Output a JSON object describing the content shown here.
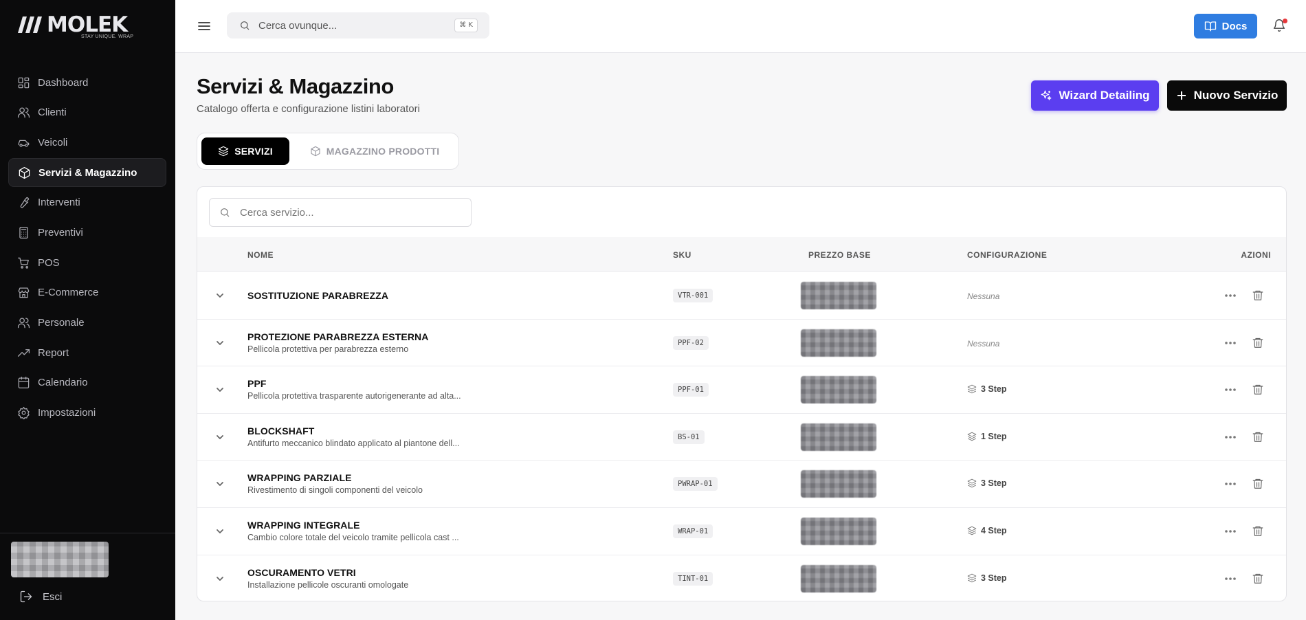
{
  "brand": {
    "name": "MOLEK",
    "tagline": "STAY UNIQUE. WRAP"
  },
  "sidebar": {
    "items": [
      {
        "label": "Dashboard",
        "icon": "dashboard-icon"
      },
      {
        "label": "Clienti",
        "icon": "users-icon"
      },
      {
        "label": "Veicoli",
        "icon": "car-icon"
      },
      {
        "label": "Servizi & Magazzino",
        "icon": "package-icon",
        "active": true
      },
      {
        "label": "Interventi",
        "icon": "wrench-icon"
      },
      {
        "label": "Preventivi",
        "icon": "calculator-icon"
      },
      {
        "label": "POS",
        "icon": "cart-icon"
      },
      {
        "label": "E-Commerce",
        "icon": "store-icon"
      },
      {
        "label": "Personale",
        "icon": "team-icon"
      },
      {
        "label": "Report",
        "icon": "trend-icon"
      },
      {
        "label": "Calendario",
        "icon": "calendar-icon"
      },
      {
        "label": "Impostazioni",
        "icon": "gear-icon"
      }
    ],
    "logout_label": "Esci"
  },
  "topbar": {
    "search_placeholder": "Cerca ovunque...",
    "shortcut": "⌘ K",
    "docs_label": "Docs"
  },
  "page": {
    "title": "Servizi & Magazzino",
    "subtitle": "Catalogo offerta e configurazione listini laboratori",
    "wizard_label": "Wizard Detailing",
    "new_label": "Nuovo Servizio"
  },
  "tabs": {
    "servizi": "SERVIZI",
    "magazzino": "MAGAZZINO PRODOTTI"
  },
  "table": {
    "search_placeholder": "Cerca servizio...",
    "headers": {
      "nome": "NOME",
      "sku": "SKU",
      "prezzo": "PREZZO BASE",
      "configurazione": "CONFIGURAZIONE",
      "azioni": "AZIONI"
    },
    "rows": [
      {
        "name": "SOSTITUZIONE PARABREZZA",
        "desc": "",
        "sku": "VTR-001",
        "config": "Nessuna",
        "steps": false
      },
      {
        "name": "PROTEZIONE PARABREZZA ESTERNA",
        "desc": "Pellicola protettiva per parabrezza esterno",
        "sku": "PPF-02",
        "config": "Nessuna",
        "steps": false
      },
      {
        "name": "PPF",
        "desc": "Pellicola protettiva trasparente autorigenerante ad alta...",
        "sku": "PPF-01",
        "config": "3 Step",
        "steps": true
      },
      {
        "name": "BLOCKSHAFT",
        "desc": "Antifurto meccanico blindato applicato al piantone dell...",
        "sku": "BS-01",
        "config": "1 Step",
        "steps": true
      },
      {
        "name": "WRAPPING PARZIALE",
        "desc": "Rivestimento di singoli componenti del veicolo",
        "sku": "PWRAP-01",
        "config": "3 Step",
        "steps": true
      },
      {
        "name": "WRAPPING INTEGRALE",
        "desc": "Cambio colore totale del veicolo tramite pellicola cast ...",
        "sku": "WRAP-01",
        "config": "4 Step",
        "steps": true
      },
      {
        "name": "OSCURAMENTO VETRI",
        "desc": "Installazione pellicole oscuranti omologate",
        "sku": "TINT-01",
        "config": "3 Step",
        "steps": true
      }
    ]
  },
  "colors": {
    "sidebar_bg": "#0b0b0c",
    "docs_blue": "#2f7de1",
    "wizard_purple": "#5b3ef0",
    "primary_black": "#0a0a0a",
    "notification_red": "#e5383b"
  }
}
